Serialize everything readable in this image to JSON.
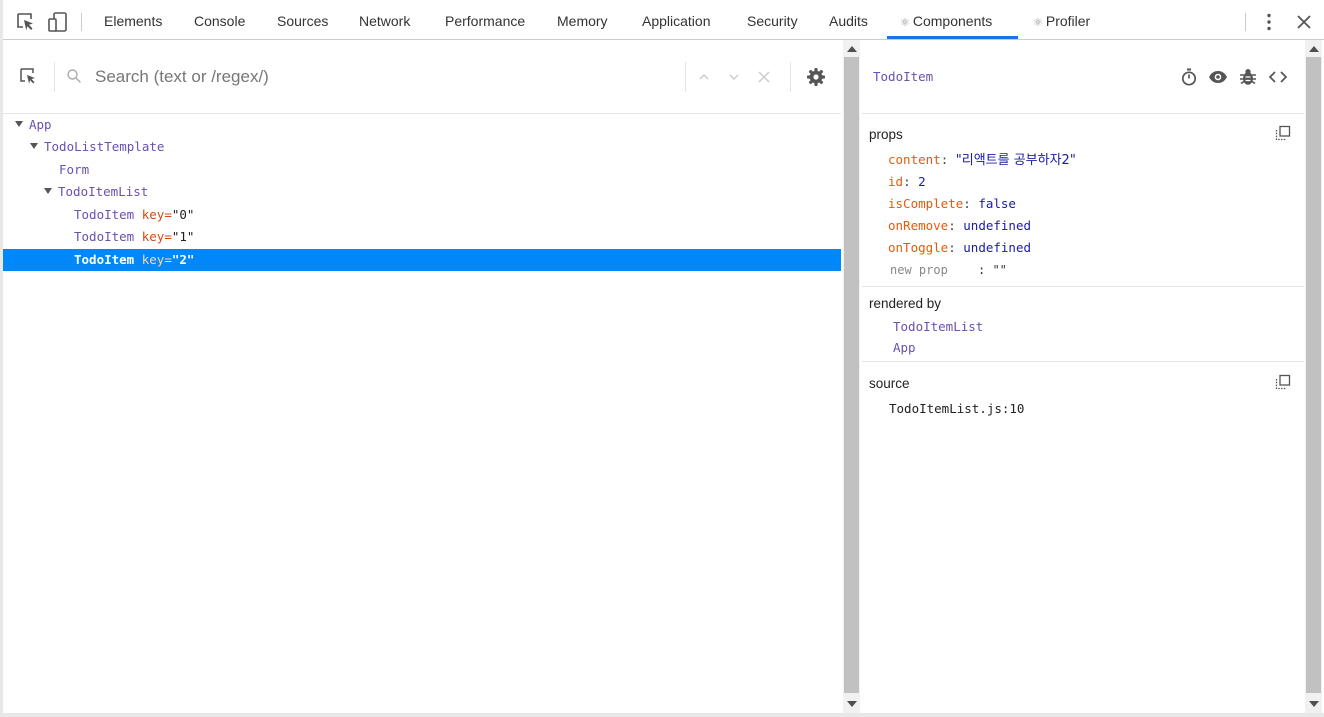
{
  "devtools": {
    "tabs": [
      {
        "label": "Elements"
      },
      {
        "label": "Console"
      },
      {
        "label": "Sources"
      },
      {
        "label": "Network"
      },
      {
        "label": "Performance"
      },
      {
        "label": "Memory"
      },
      {
        "label": "Application"
      },
      {
        "label": "Security"
      },
      {
        "label": "Audits"
      },
      {
        "label": "Components",
        "active": true
      },
      {
        "label": "Profiler"
      }
    ],
    "accent_color": "#1a73e8"
  },
  "search": {
    "placeholder": "Search (text or /regex/)",
    "value": ""
  },
  "tree": {
    "rows": [
      {
        "name": "App",
        "expanded": true
      },
      {
        "name": "TodoListTemplate",
        "expanded": true
      },
      {
        "name": "Form"
      },
      {
        "name": "TodoItemList",
        "expanded": true
      },
      {
        "name": "TodoItem",
        "key_label": "key",
        "key_value": "\"0\""
      },
      {
        "name": "TodoItem",
        "key_label": "key",
        "key_value": "\"1\""
      },
      {
        "name": "TodoItem",
        "key_label": "key",
        "key_value": "\"2\"",
        "selected": true
      }
    ],
    "selected_color": "#0088fa"
  },
  "inspector": {
    "component_name": "TodoItem",
    "props_title": "props",
    "props": [
      {
        "key": "content",
        "value": "\"리액트를 공부하자2\"",
        "kind": "string"
      },
      {
        "key": "id",
        "value": "2",
        "kind": "number"
      },
      {
        "key": "isComplete",
        "value": "false",
        "kind": "value"
      },
      {
        "key": "onRemove",
        "value": "undefined",
        "kind": "value"
      },
      {
        "key": "onToggle",
        "value": "undefined",
        "kind": "value"
      }
    ],
    "new_prop": {
      "label": "new prop",
      "value": ": \"\""
    },
    "rendered_by_title": "rendered by",
    "rendered_by": [
      "TodoItemList",
      "App"
    ],
    "source_title": "source",
    "source_value": "TodoItemList.js:10"
  }
}
